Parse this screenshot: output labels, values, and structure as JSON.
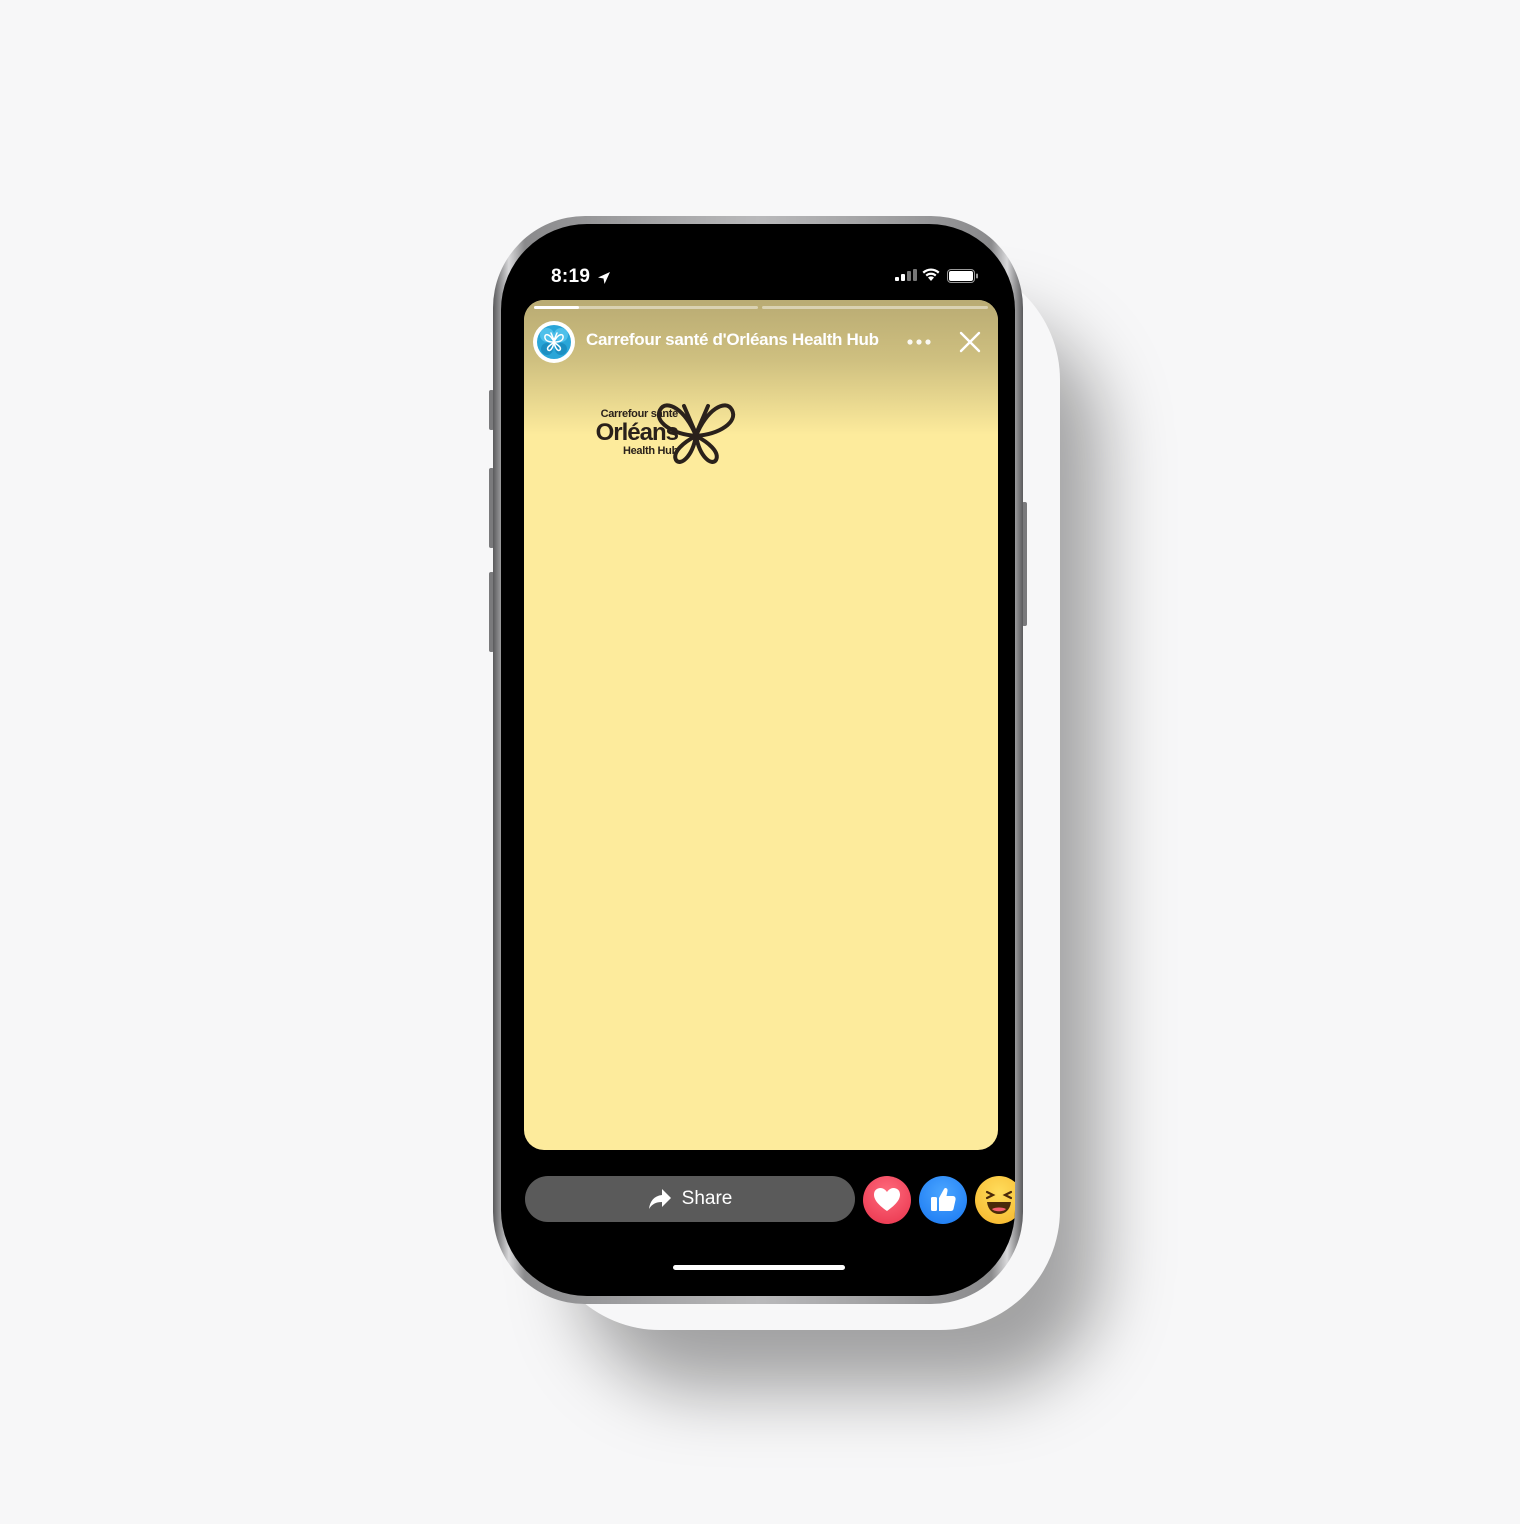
{
  "status_bar": {
    "time": "8:19",
    "location_icon": "location-arrow-icon",
    "signal_icon": "cellular-signal-icon",
    "wifi_icon": "wifi-icon",
    "battery_icon": "battery-icon"
  },
  "story": {
    "page_name": "Carrefour santé d'Orléans Health Hub",
    "avatar_icon": "butterfly-icon",
    "progress_segments": [
      {
        "progress": 0.2
      },
      {
        "progress": 0
      }
    ],
    "more_icon": "more-horizontal-icon",
    "close_icon": "close-icon",
    "background_color": "#fdeb9c",
    "logo": {
      "line1": "Carrefour santé",
      "line2": "Orléans",
      "line3": "Health Hub",
      "icon": "butterfly-icon"
    }
  },
  "actions": {
    "share_label": "Share",
    "share_icon": "share-arrow-icon",
    "reactions": [
      {
        "name": "love",
        "icon": "heart-icon",
        "color": "#e8324b"
      },
      {
        "name": "like",
        "icon": "thumbs-up-icon",
        "color": "#1877f2"
      },
      {
        "name": "haha",
        "icon": "laughing-face-icon",
        "color": "#f5b42a"
      }
    ]
  }
}
